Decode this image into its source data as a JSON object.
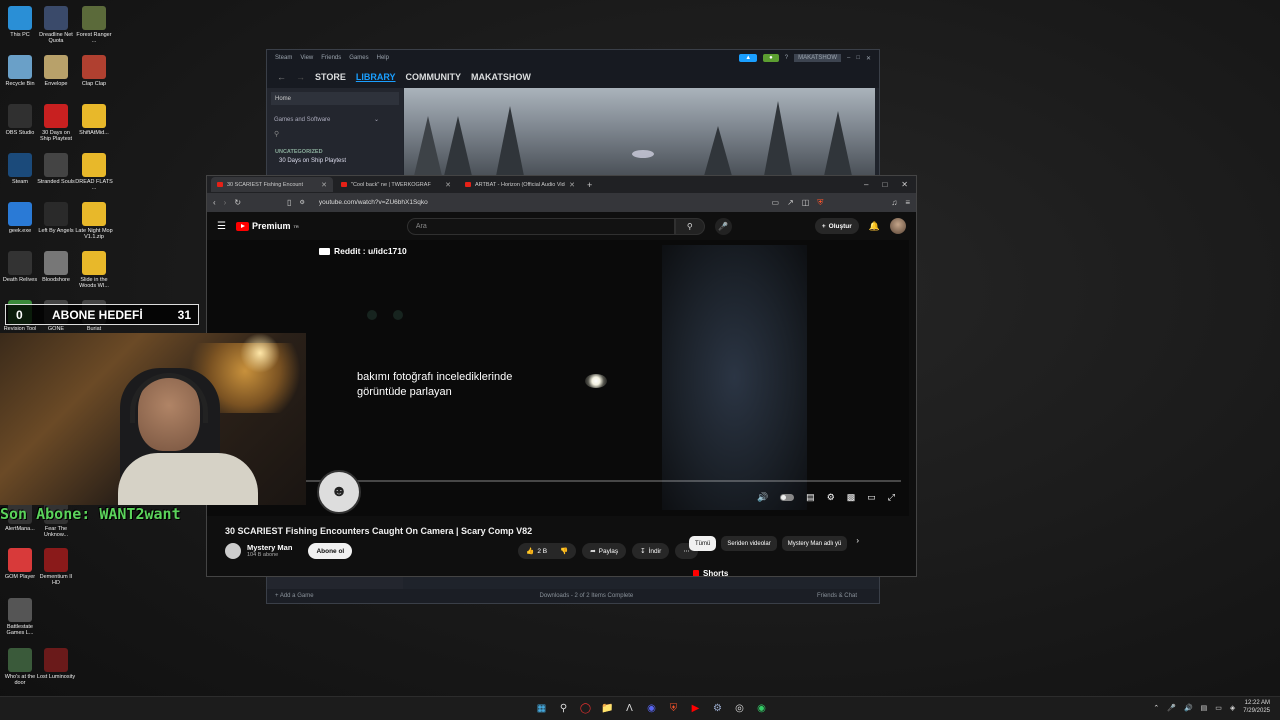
{
  "desktop": {
    "icons": [
      {
        "label": "This PC",
        "icon": "monitor-icon",
        "color": "#2a8fd6"
      },
      {
        "label": "Dreadline Net Quota",
        "icon": "game-icon",
        "color": "#3a4a6a"
      },
      {
        "label": "Forest Ranger ...",
        "icon": "game-icon",
        "color": "#5b6a3a"
      },
      {
        "label": "Recycle Bin",
        "icon": "recycle-bin-icon",
        "color": "#6aa0c8"
      },
      {
        "label": "Envelope",
        "icon": "envelope-icon",
        "color": "#b8a16a"
      },
      {
        "label": "Clap Clap",
        "icon": "game-icon",
        "color": "#b04030"
      },
      {
        "label": "OBS Studio",
        "icon": "obs-icon",
        "color": "#303030"
      },
      {
        "label": "30 Days on Ship Playtest",
        "icon": "game-icon",
        "color": "#c82020"
      },
      {
        "label": "ShiftAtMid...",
        "icon": "folder-icon",
        "color": "#e8b82a"
      },
      {
        "label": "Steam",
        "icon": "steam-icon",
        "color": "#1b4a7a"
      },
      {
        "label": "Stranded Souls",
        "icon": "game-icon",
        "color": "#444"
      },
      {
        "label": "DREAD FLATS ...",
        "icon": "folder-icon",
        "color": "#e8b82a"
      },
      {
        "label": "geek.exe",
        "icon": "geek-icon",
        "color": "#2a7ad6"
      },
      {
        "label": "Left By Angels",
        "icon": "game-icon",
        "color": "#2a2a2a"
      },
      {
        "label": "Late Night Mop V1.1.zip",
        "icon": "folder-icon",
        "color": "#e8b82a"
      },
      {
        "label": "Death Relives",
        "icon": "game-icon",
        "color": "#333"
      },
      {
        "label": "Bloodshore",
        "icon": "game-icon",
        "color": "#777"
      },
      {
        "label": "Slide in the Woods WI...",
        "icon": "folder-icon",
        "color": "#e8b82a"
      },
      {
        "label": "Revision Tool",
        "icon": "tool-icon",
        "color": "#3a8a3a"
      },
      {
        "label": "GONE",
        "icon": "game-icon",
        "color": "#444"
      },
      {
        "label": "Buriat",
        "icon": "game-icon",
        "color": "#444"
      },
      {
        "label": "AlertMana...",
        "icon": "app-icon",
        "color": "#333"
      },
      {
        "label": "Fear The Unknow...",
        "icon": "game-icon",
        "color": "#333"
      },
      {
        "label": "GOM Player",
        "icon": "player-icon",
        "color": "#d83a3a"
      },
      {
        "label": "Dementium II HD",
        "icon": "game-icon",
        "color": "#8a1a1a"
      },
      {
        "label": "Battlestate Games L...",
        "icon": "launcher-icon",
        "color": "#555"
      },
      {
        "label": "Who's at the door",
        "icon": "game-icon",
        "color": "#3a5a3a"
      },
      {
        "label": "Lost Luminosity",
        "icon": "game-icon",
        "color": "#6a1a1a"
      }
    ]
  },
  "steam": {
    "menu": [
      "Steam",
      "View",
      "Friends",
      "Games",
      "Help"
    ],
    "nav": {
      "store": "STORE",
      "library": "LIBRARY",
      "community": "COMMUNITY",
      "user": "MAKATSHOW"
    },
    "account": "MAKATSHOW",
    "sidebar": {
      "home": "Home",
      "filter": "Games and Software",
      "category": "UNCATEGORIZED",
      "item": "30 Days on Ship Playtest"
    },
    "bottom": {
      "add_game": "Add a Game",
      "downloads": "Downloads - 2 of 2 Items Complete",
      "friends": "Friends & Chat"
    }
  },
  "browser": {
    "tabs": [
      {
        "title": "30 SCARIEST Fishing Encount",
        "active": true
      },
      {
        "title": "\"Cool back\" ne | TWERKOGRAF",
        "active": false
      },
      {
        "title": "ARTBAT - Horizon (Official Audio Vide",
        "active": false
      }
    ],
    "url": "youtube.com/watch?v=ZU6bhX1Sqko"
  },
  "youtube": {
    "logo": "Premium",
    "logo_badge": "TR",
    "search_placeholder": "Ara",
    "create": "Oluştur",
    "video": {
      "credit": "Reddit : u/idc1710",
      "subtitle_line1": "bakımı fotoğrafı incelediklerinde",
      "subtitle_line2": "görüntüde parlayan",
      "progress": 0.14
    },
    "title": "30 SCARIEST Fishing Encounters Caught On Camera | Scary Comp V82",
    "channel": {
      "name": "Mystery Man",
      "subs": "104 B abone",
      "subscribe": "Abone ol"
    },
    "actions": {
      "likes": "2 B",
      "share": "Paylaş",
      "download": "İndir"
    },
    "chips": [
      "Tümü",
      "Seriden videolar",
      "Mystery Man adlı yü"
    ],
    "shorts": "Shorts"
  },
  "overlay": {
    "goal_label": "ABONE HEDEFİ",
    "goal_count": "31",
    "goal_left": "0",
    "last_sub": "Son Abone: WANT2want"
  },
  "taskbar": {
    "time": "12:22 AM",
    "date": "7/29/2025"
  }
}
